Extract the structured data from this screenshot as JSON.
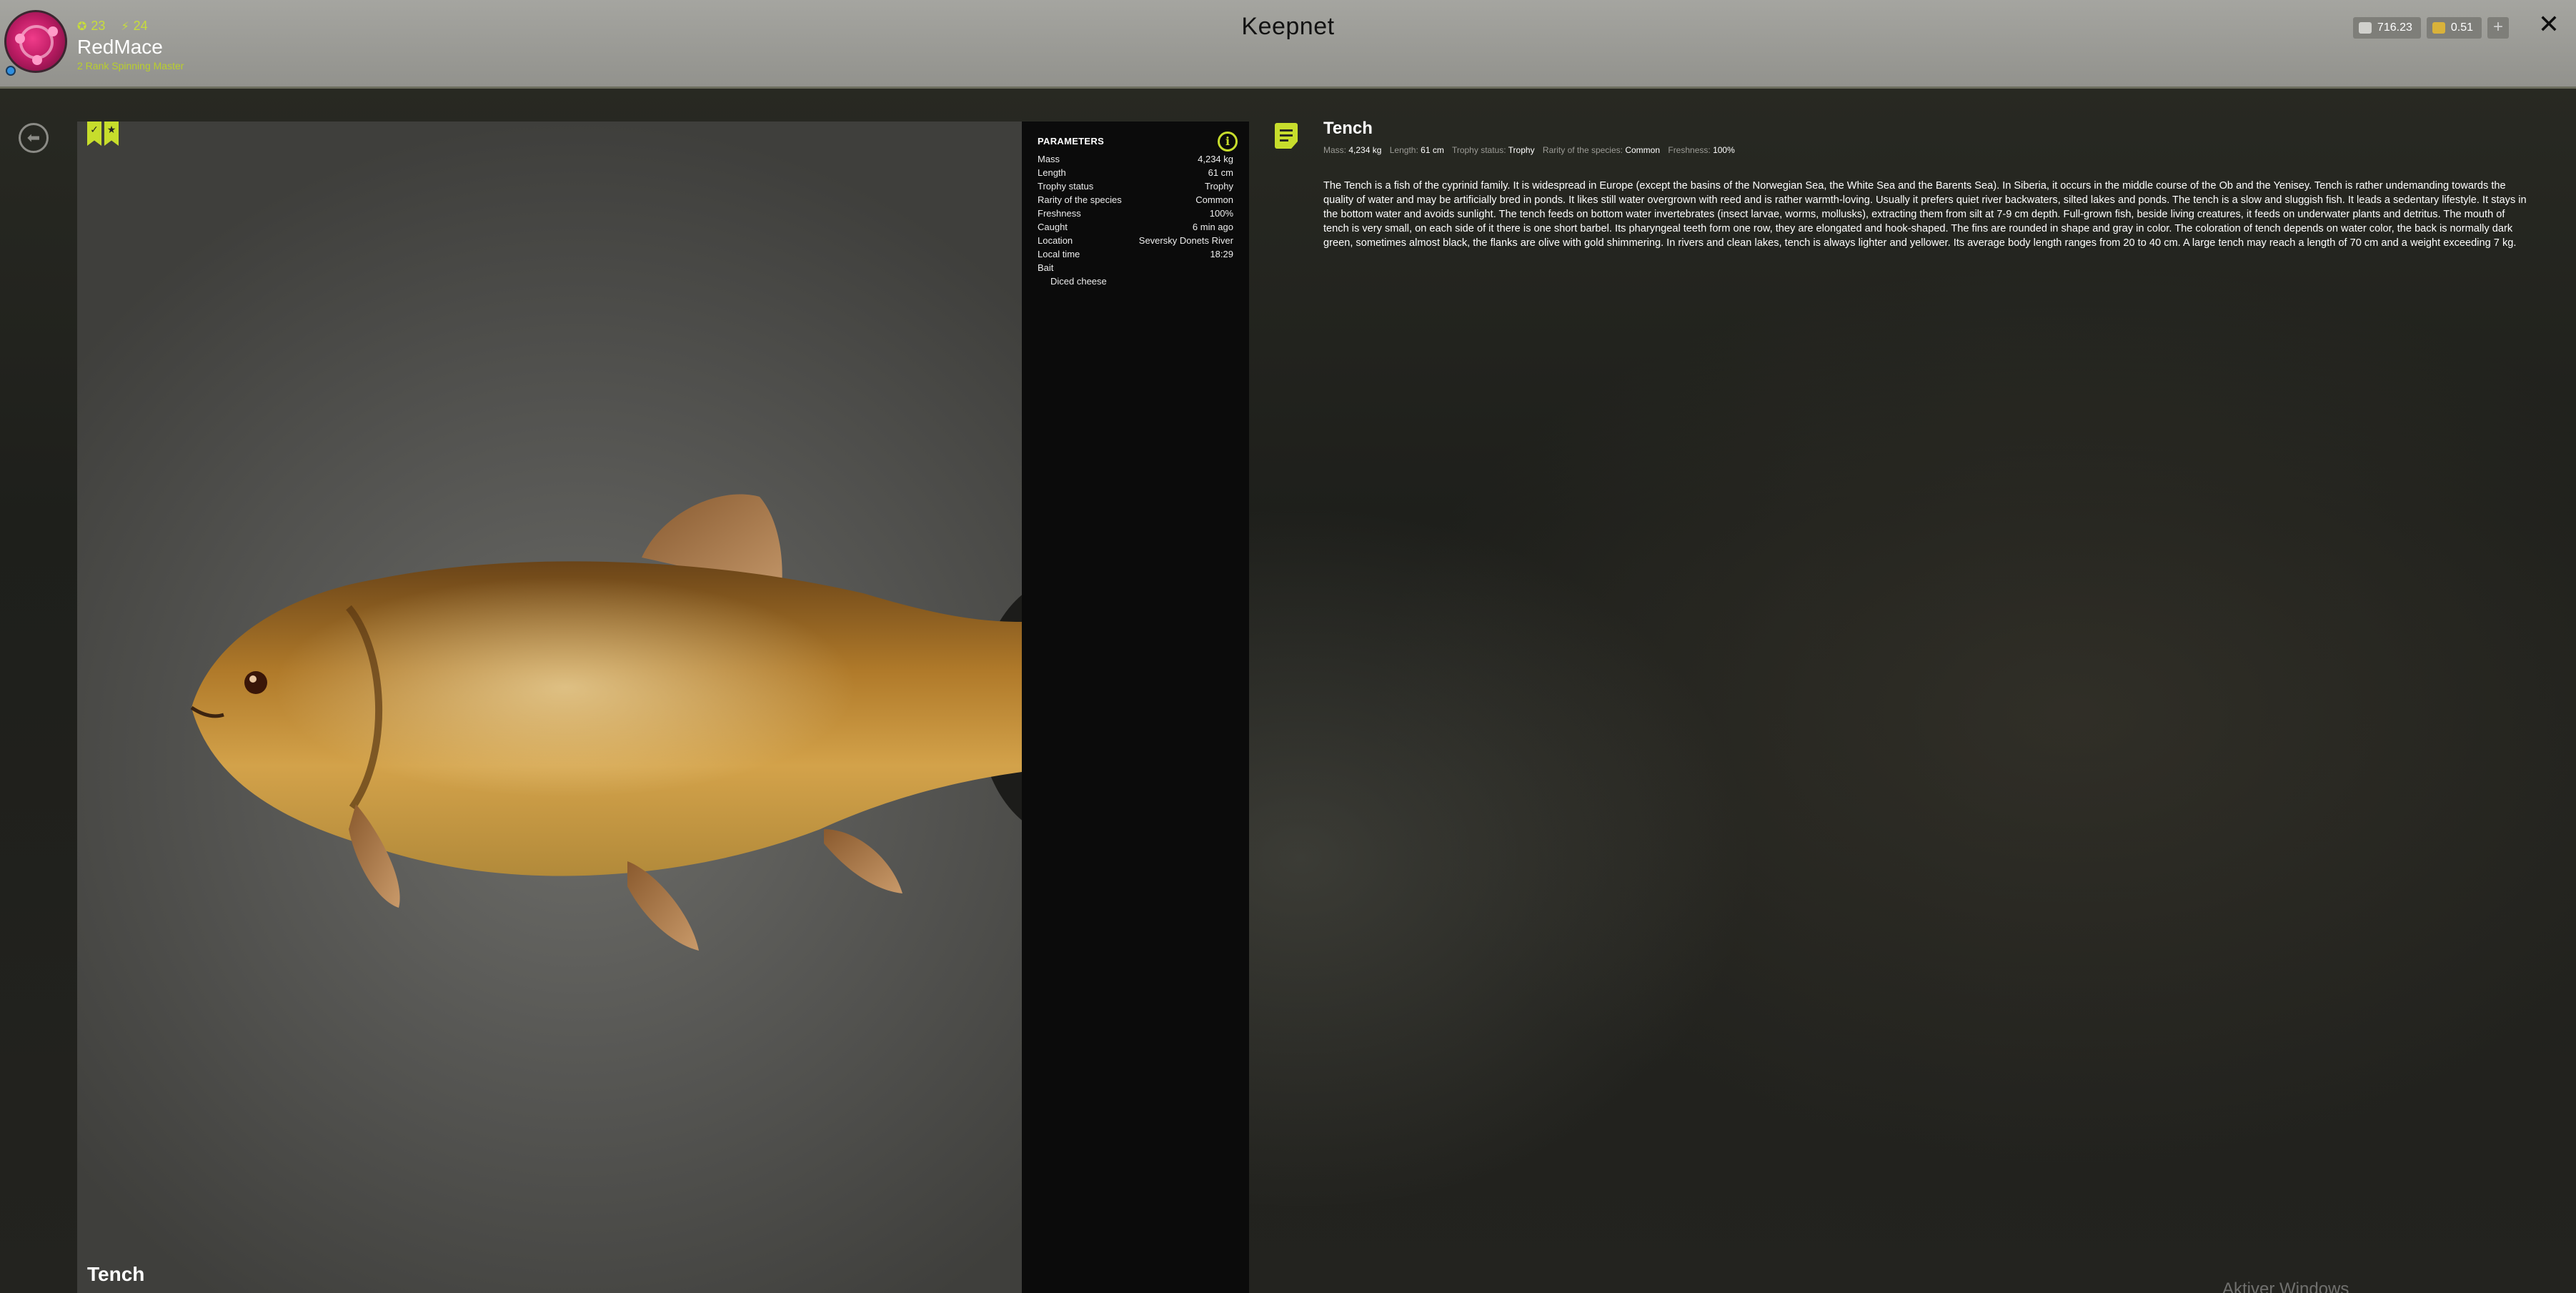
{
  "header": {
    "title": "Keepnet",
    "user": {
      "name": "RedMace",
      "rank": "2 Rank Spinning Master",
      "stat_a": "23",
      "stat_b": "24"
    },
    "currency": [
      {
        "icon": "silver-coin-icon",
        "value": "716.23",
        "color": "#c9c9c9"
      },
      {
        "icon": "gold-coin-icon",
        "value": "0.51",
        "color": "#d9b23a"
      }
    ],
    "add_label": "+",
    "close_label": "✕"
  },
  "viewer": {
    "fish_name": "Tench",
    "marks": [
      "✓",
      "★"
    ]
  },
  "parameters": {
    "title": "PARAMETERS",
    "rows": [
      {
        "label": "Mass",
        "value": "4,234 kg"
      },
      {
        "label": "Length",
        "value": "61 cm"
      },
      {
        "label": "Trophy status",
        "value": "Trophy"
      },
      {
        "label": "Rarity of the species",
        "value": "Common"
      },
      {
        "label": "Freshness",
        "value": "100%"
      },
      {
        "label": "Caught",
        "value": "6 min ago"
      },
      {
        "label": "Location",
        "value": "Seversky Donets River"
      },
      {
        "label": "Local time",
        "value": "18:29"
      }
    ],
    "bait_label": "Bait",
    "bait_value": "Diced cheese"
  },
  "description": {
    "title": "Tench",
    "meta": [
      {
        "label": "Mass:",
        "value": "4,234 kg"
      },
      {
        "label": "Length:",
        "value": "61 cm"
      },
      {
        "label": "Trophy status:",
        "value": "Trophy"
      },
      {
        "label": "Rarity of the species:",
        "value": "Common"
      },
      {
        "label": "Freshness:",
        "value": "100%"
      }
    ],
    "text": "The Tench is a fish of the cyprinid family. It is widespread in Europe (except the basins of the Norwegian Sea, the White Sea and the Barents Sea). In Siberia, it occurs in the middle course of the Ob and the Yenisey. Tench is rather undemanding towards the quality of water and may be artificially bred in ponds. It likes still water overgrown with reed and is rather warmth-loving. Usually it prefers quiet river backwaters, silted lakes and ponds. The tench is a slow and sluggish fish. It leads a sedentary lifestyle. It stays in the bottom water and avoids sunlight. The tench feeds on bottom water invertebrates (insect larvae, worms, mollusks), extracting them from silt at 7-9 cm depth. Full-grown fish, beside living creatures, it feeds on underwater plants and detritus. The mouth of tench is very small, on each side of it there is one short barbel. Its pharyngeal teeth form one row, they are elongated and hook-shaped. The fins are rounded in shape and gray in color. The coloration of tench depends on water color, the back is normally dark green, sometimes almost black, the flanks are olive with gold shimmering. In rivers and clean lakes, tench is always lighter and yellower. Its average body length ranges from 20 to 40 cm. A large tench may reach a length of 70 cm and a weight exceeding 7 kg."
  },
  "watermark": "Aktiver Windows"
}
